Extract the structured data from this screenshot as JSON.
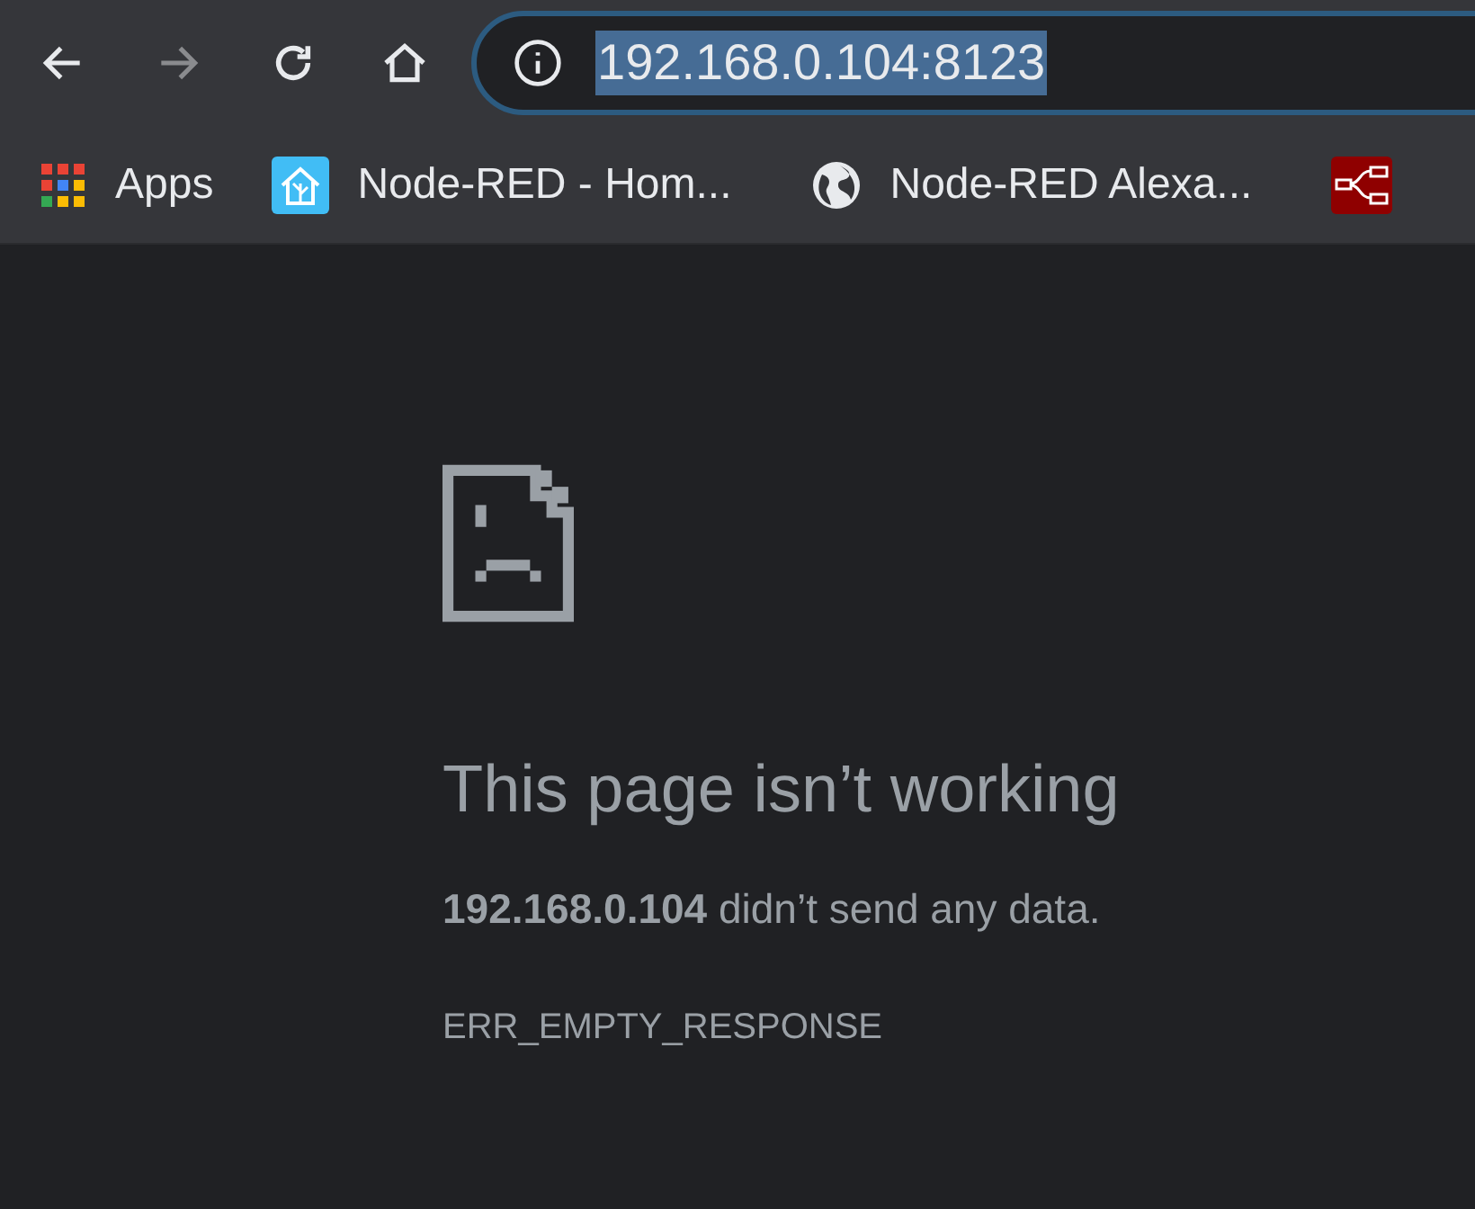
{
  "toolbar": {
    "back": {
      "disabled": false
    },
    "forward": {
      "disabled": true
    },
    "address": {
      "value": "192.168.0.104:8123",
      "selected": true
    }
  },
  "bookmarks": [
    {
      "kind": "apps",
      "label": "Apps"
    },
    {
      "kind": "home",
      "label": "Node-RED - Hom..."
    },
    {
      "kind": "globe",
      "label": "Node-RED Alexa..."
    },
    {
      "kind": "node"
    }
  ],
  "error": {
    "title": "This page isn’t working",
    "detail": "**192.168.0.104** didn’t send any data.",
    "code": "ERR_EMPTY_RESPONSE"
  }
}
